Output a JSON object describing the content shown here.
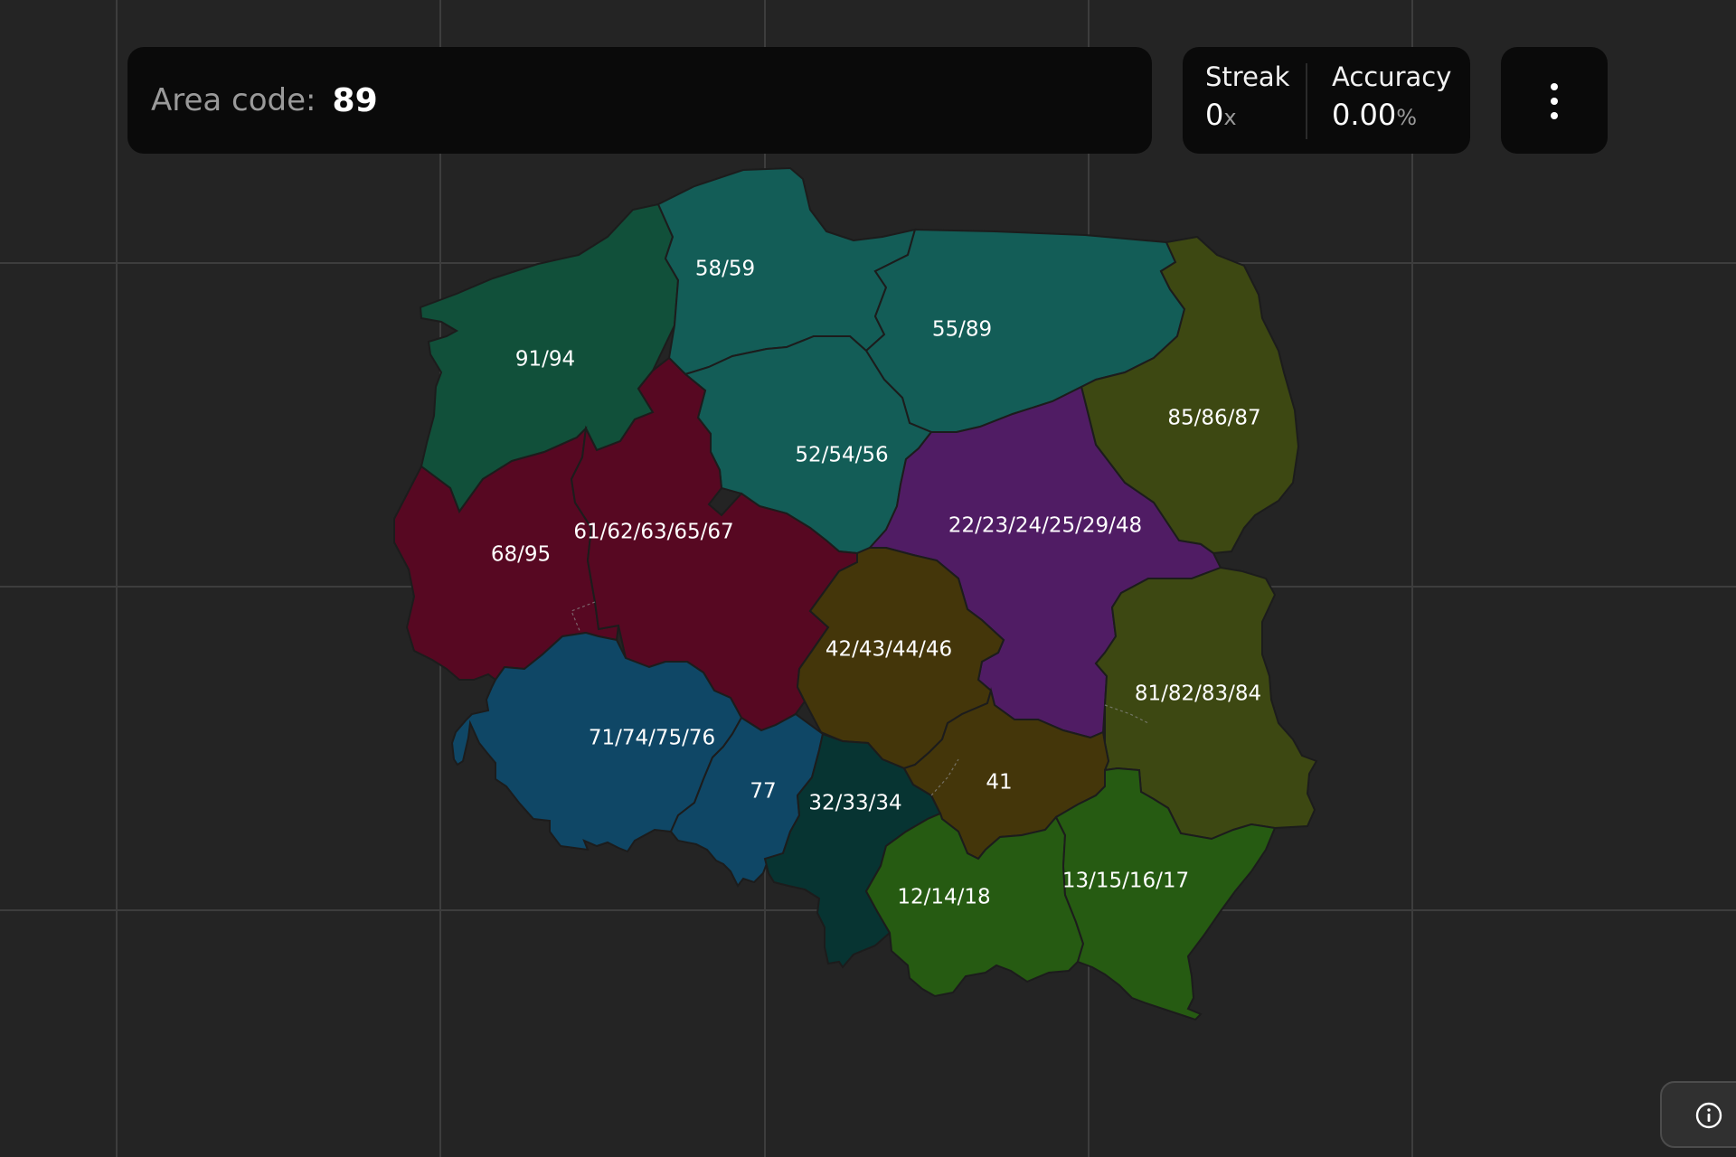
{
  "header": {
    "area_code_label": "Area code:",
    "area_code_value": "89"
  },
  "stats": {
    "streak_label": "Streak",
    "streak_value": "0",
    "streak_unit": "x",
    "accuracy_label": "Accuracy",
    "accuracy_value": "0.00",
    "accuracy_unit": "%"
  },
  "menu": {
    "icon": "kebab-menu-icon"
  },
  "info": {
    "icon": "info-icon"
  },
  "map": {
    "country": "Poland",
    "regions": [
      {
        "id": "91-94",
        "label": "91/94",
        "color": "#11503a"
      },
      {
        "id": "58-59",
        "label": "58/59",
        "color": "#135d57"
      },
      {
        "id": "55-89",
        "label": "55/89",
        "color": "#135d57"
      },
      {
        "id": "52-54-56",
        "label": "52/54/56",
        "color": "#135d57"
      },
      {
        "id": "85-86-87",
        "label": "85/86/87",
        "color": "#3d4812"
      },
      {
        "id": "22-23-24-25-29-48",
        "label": "22/23/24/25/29/48",
        "color": "#501c64"
      },
      {
        "id": "68-95",
        "label": "68/95",
        "color": "#570822"
      },
      {
        "id": "61-62-63-65-67",
        "label": "61/62/63/65/67",
        "color": "#570822"
      },
      {
        "id": "42-43-44-46",
        "label": "42/43/44/46",
        "color": "#44360a"
      },
      {
        "id": "81-82-83-84",
        "label": "81/82/83/84",
        "color": "#3d4812"
      },
      {
        "id": "71-74-75-76",
        "label": "71/74/75/76",
        "color": "#0f4766"
      },
      {
        "id": "77",
        "label": "77",
        "color": "#0f4766"
      },
      {
        "id": "32-33-34",
        "label": "32/33/34",
        "color": "#073432"
      },
      {
        "id": "41",
        "label": "41",
        "color": "#44360a"
      },
      {
        "id": "12-14-18",
        "label": "12/14/18",
        "color": "#265b12"
      },
      {
        "id": "13-15-16-17",
        "label": "13/15/16/17",
        "color": "#265b12"
      }
    ]
  }
}
